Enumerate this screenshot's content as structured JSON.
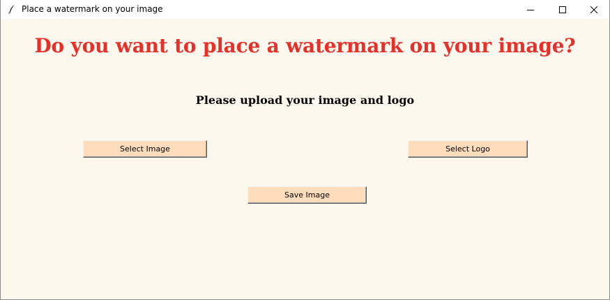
{
  "window": {
    "title": "Place a watermark on your image",
    "icons": {
      "app": "feather-icon",
      "minimize": "minimize-icon",
      "maximize": "maximize-icon",
      "close": "close-icon"
    }
  },
  "main": {
    "headline": "Do you want to place a watermark on your image?",
    "subtitle": "Please upload your image and logo",
    "buttons": {
      "select_image": "Select Image",
      "select_logo": "Select Logo",
      "save_image": "Save Image"
    }
  },
  "colors": {
    "background": "#fdf8ee",
    "headline": "#e8302a",
    "button": "#ffdcbc"
  }
}
